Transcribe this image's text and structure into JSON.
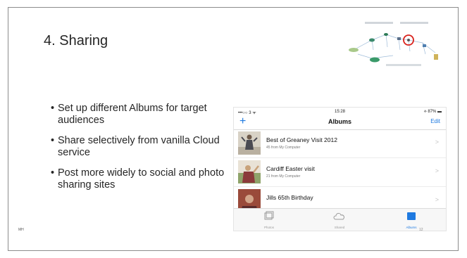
{
  "slide": {
    "title": "4. Sharing",
    "bullets": [
      "Set up different Albums for target audiences",
      "Share selectively from vanilla Cloud service",
      "Post more widely to social and photo sharing sites"
    ],
    "bullet_glyph": "•",
    "footer_left": "MH",
    "page_number": "12",
    "accent_circle_color": "#d9211b"
  },
  "phone": {
    "status_left": "•••○○ 3 ᯤ",
    "status_time": "15:28",
    "status_right": "⟡ 87% ▬",
    "nav_add": "+",
    "nav_title": "Albums",
    "nav_edit": "Edit",
    "albums": [
      {
        "name": "Best of Greaney Visit 2012",
        "count": "45 from My Computer"
      },
      {
        "name": "Cardiff Easter visit",
        "count": "21 from My Computer"
      },
      {
        "name": "Jills 65th Birthday",
        "count": ""
      }
    ],
    "chevron": ">",
    "tabs": [
      {
        "label": "Photos",
        "icon": "photos-icon"
      },
      {
        "label": "Shared",
        "icon": "cloud-icon"
      },
      {
        "label": "Albums",
        "icon": "albums-icon"
      }
    ],
    "accent_color": "#1f7ae0"
  }
}
